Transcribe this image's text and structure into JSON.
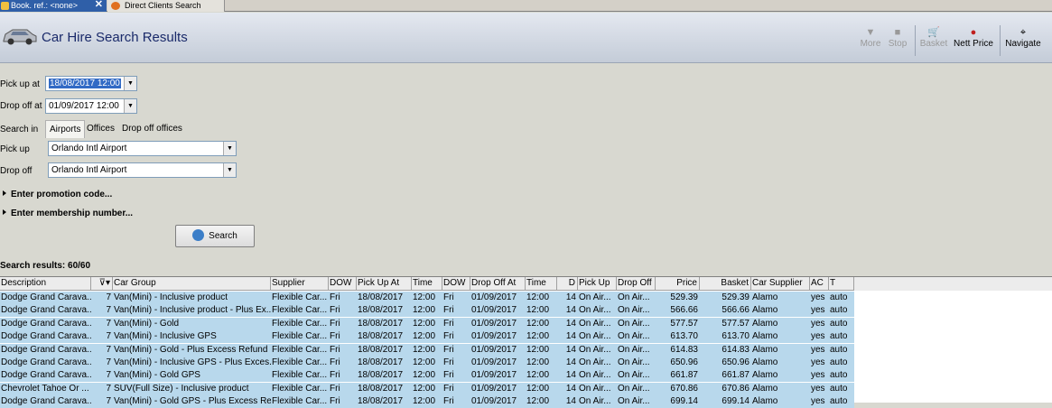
{
  "tabs": [
    {
      "label": "Book. ref.: <none>"
    },
    {
      "label": "Direct Clients Search"
    }
  ],
  "header": {
    "title": "Car Hire Search Results"
  },
  "toolbar": {
    "more": "More",
    "stop": "Stop",
    "basket": "Basket",
    "nett_price": "Nett Price",
    "navigate": "Navigate"
  },
  "form": {
    "pickup_at_label": "Pick up at",
    "pickup_at_value": "18/08/2017 12:00",
    "dropoff_at_label": "Drop off at",
    "dropoff_at_value": "01/09/2017 12:00",
    "search_in_label": "Search in",
    "search_in_tabs": [
      "Airports",
      "Offices",
      "Drop off offices"
    ],
    "pickup_label": "Pick up",
    "pickup_value": "Orlando Intl Airport",
    "dropoff_label": "Drop off",
    "dropoff_value": "Orlando Intl Airport",
    "promo": "Enter promotion code...",
    "membership": "Enter membership number...",
    "search_button": "Search"
  },
  "results_label": "Search results: 60/60",
  "columns": [
    "Description",
    "",
    "Car Group",
    "Supplier",
    "DOW",
    "Pick Up At",
    "Time",
    "DOW",
    "Drop Off At",
    "Time",
    "D",
    "Pick Up",
    "Drop Off",
    "Price",
    "Basket",
    "Car Supplier",
    "AC",
    "T"
  ],
  "rows": [
    [
      "Dodge Grand Carava...",
      "7",
      "Van(Mini) - Inclusive product",
      "Flexible Car...",
      "Fri",
      "18/08/2017",
      "12:00",
      "Fri",
      "01/09/2017",
      "12:00",
      "14",
      "On Air...",
      "On Air...",
      "529.39",
      "529.39",
      "Alamo",
      "yes",
      "auto"
    ],
    [
      "Dodge Grand Carava...",
      "7",
      "Van(Mini) - Inclusive product - Plus Ex...",
      "Flexible Car...",
      "Fri",
      "18/08/2017",
      "12:00",
      "Fri",
      "01/09/2017",
      "12:00",
      "14",
      "On Air...",
      "On Air...",
      "566.66",
      "566.66",
      "Alamo",
      "yes",
      "auto"
    ],
    [
      "Dodge Grand Carava...",
      "7",
      "Van(Mini) - Gold",
      "Flexible Car...",
      "Fri",
      "18/08/2017",
      "12:00",
      "Fri",
      "01/09/2017",
      "12:00",
      "14",
      "On Air...",
      "On Air...",
      "577.57",
      "577.57",
      "Alamo",
      "yes",
      "auto"
    ],
    [
      "Dodge Grand Carava...",
      "7",
      "Van(Mini) - Inclusive GPS",
      "Flexible Car...",
      "Fri",
      "18/08/2017",
      "12:00",
      "Fri",
      "01/09/2017",
      "12:00",
      "14",
      "On Air...",
      "On Air...",
      "613.70",
      "613.70",
      "Alamo",
      "yes",
      "auto"
    ],
    [
      "Dodge Grand Carava...",
      "7",
      "Van(Mini) - Gold - Plus Excess Refund",
      "Flexible Car...",
      "Fri",
      "18/08/2017",
      "12:00",
      "Fri",
      "01/09/2017",
      "12:00",
      "14",
      "On Air...",
      "On Air...",
      "614.83",
      "614.83",
      "Alamo",
      "yes",
      "auto"
    ],
    [
      "Dodge Grand Carava...",
      "7",
      "Van(Mini) - Inclusive GPS - Plus Exces...",
      "Flexible Car...",
      "Fri",
      "18/08/2017",
      "12:00",
      "Fri",
      "01/09/2017",
      "12:00",
      "14",
      "On Air...",
      "On Air...",
      "650.96",
      "650.96",
      "Alamo",
      "yes",
      "auto"
    ],
    [
      "Dodge Grand Carava...",
      "7",
      "Van(Mini) - Gold GPS",
      "Flexible Car...",
      "Fri",
      "18/08/2017",
      "12:00",
      "Fri",
      "01/09/2017",
      "12:00",
      "14",
      "On Air...",
      "On Air...",
      "661.87",
      "661.87",
      "Alamo",
      "yes",
      "auto"
    ],
    [
      "Chevrolet Tahoe Or ...",
      "7",
      "SUV(Full Size) - Inclusive product",
      "Flexible Car...",
      "Fri",
      "18/08/2017",
      "12:00",
      "Fri",
      "01/09/2017",
      "12:00",
      "14",
      "On Air...",
      "On Air...",
      "670.86",
      "670.86",
      "Alamo",
      "yes",
      "auto"
    ],
    [
      "Dodge Grand Carava...",
      "7",
      "Van(Mini) - Gold GPS - Plus Excess Ref...",
      "Flexible Car...",
      "Fri",
      "18/08/2017",
      "12:00",
      "Fri",
      "01/09/2017",
      "12:00",
      "14",
      "On Air...",
      "On Air...",
      "699.14",
      "699.14",
      "Alamo",
      "yes",
      "auto"
    ]
  ]
}
